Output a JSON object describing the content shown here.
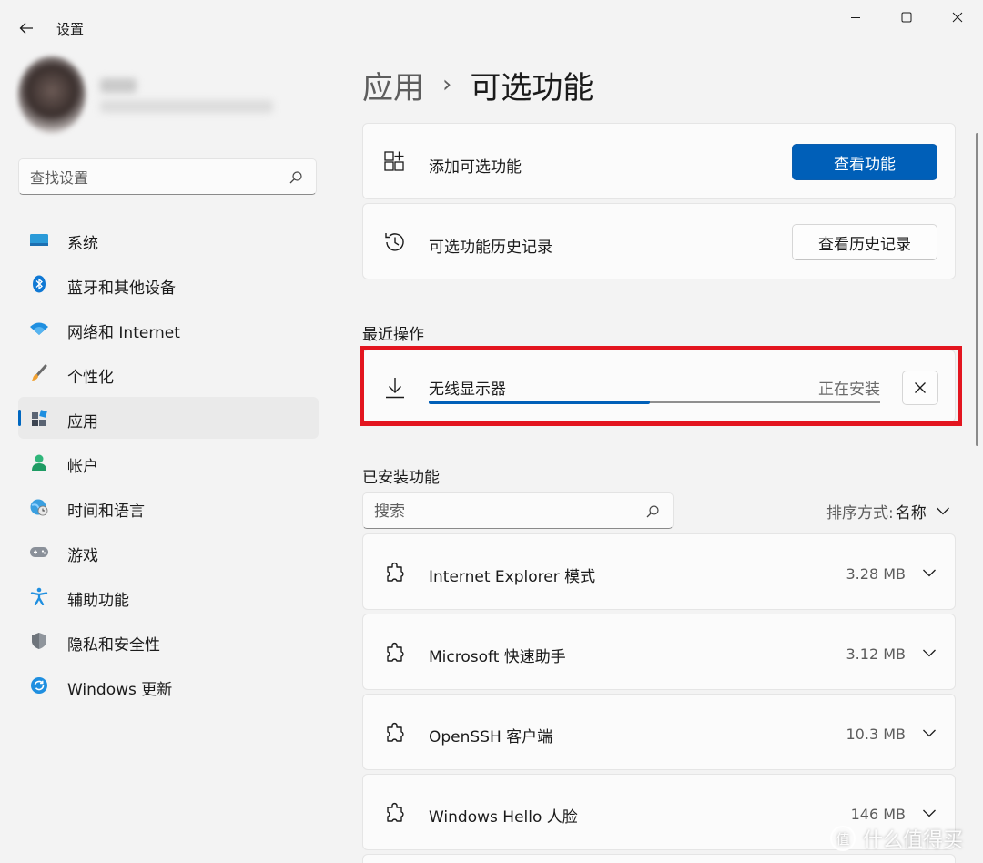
{
  "window": {
    "title": "设置",
    "back_icon": "arrow-left-icon",
    "minimize_icon": "minimize-icon",
    "maximize_icon": "maximize-icon",
    "close_icon": "close-icon"
  },
  "sidebar": {
    "search_placeholder": "查找设置",
    "items": [
      {
        "label": "系统",
        "icon": "monitor-icon",
        "active": false
      },
      {
        "label": "蓝牙和其他设备",
        "icon": "bluetooth-icon",
        "active": false
      },
      {
        "label": "网络和 Internet",
        "icon": "wifi-icon",
        "active": false
      },
      {
        "label": "个性化",
        "icon": "brush-icon",
        "active": false
      },
      {
        "label": "应用",
        "icon": "apps-icon",
        "active": true
      },
      {
        "label": "帐户",
        "icon": "person-icon",
        "active": false
      },
      {
        "label": "时间和语言",
        "icon": "globe-clock-icon",
        "active": false
      },
      {
        "label": "游戏",
        "icon": "gamepad-icon",
        "active": false
      },
      {
        "label": "辅助功能",
        "icon": "accessibility-icon",
        "active": false
      },
      {
        "label": "隐私和安全性",
        "icon": "shield-icon",
        "active": false
      },
      {
        "label": "Windows 更新",
        "icon": "update-icon",
        "active": false
      }
    ]
  },
  "breadcrumb": {
    "parent": "应用",
    "separator": "›",
    "current": "可选功能"
  },
  "add_feature": {
    "label": "添加可选功能",
    "button": "查看功能"
  },
  "history": {
    "label": "可选功能历史记录",
    "button": "查看历史记录"
  },
  "recent": {
    "title": "最近操作",
    "item_name": "无线显示器",
    "status": "正在安装",
    "progress": 0.49
  },
  "installed": {
    "title": "已安装功能",
    "search_placeholder": "搜索",
    "sort_label": "排序方式:",
    "sort_value": "名称",
    "features": [
      {
        "name": "Internet Explorer 模式",
        "size": "3.28 MB"
      },
      {
        "name": "Microsoft 快速助手",
        "size": "3.12 MB"
      },
      {
        "name": "OpenSSH 客户端",
        "size": "10.3 MB"
      },
      {
        "name": "Windows Hello 人脸",
        "size": "146 MB"
      }
    ]
  },
  "watermark": {
    "badge": "值",
    "text": "什么值得买"
  },
  "colors": {
    "accent": "#005fb8",
    "highlight_border": "#e3151f",
    "background": "#f3f3f3",
    "card": "#fbfbfb"
  }
}
